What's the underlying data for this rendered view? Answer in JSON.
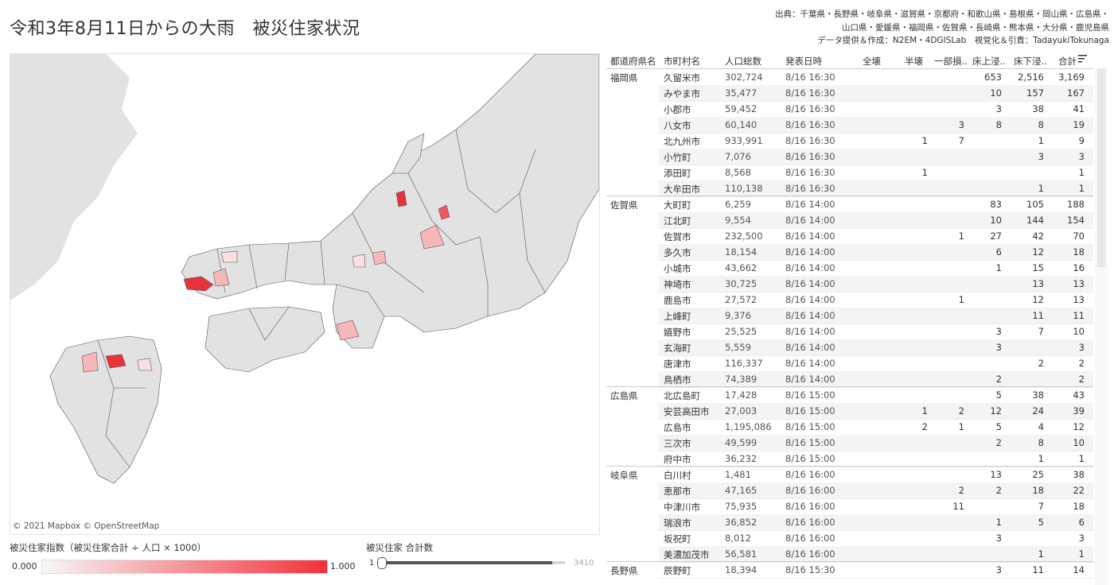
{
  "title": "令和3年8月11日からの大雨　被災住家状況",
  "source_lines": [
    "出典：千葉県・長野県・岐阜県・滋賀県・京都府・和歌山県・島根県・岡山県・広島県・",
    "山口県・愛媛県・福岡県・佐賀県・長崎県・熊本県・大分県・鹿児島県",
    "データ提供＆作成：N2EM・4DGISLab　視覚化＆引責：TadayukiTokunaga"
  ],
  "map": {
    "credit": "© 2021 Mapbox  © OpenStreetMap",
    "base_color": "#e2e2e2",
    "highlight_color": "#e8333c"
  },
  "legend": {
    "title": "被災住家指数（被災住家合計 ÷ 人口 × 1000）",
    "min": "0.000",
    "max": "1.000"
  },
  "slider": {
    "title": "被災住家 合計数",
    "min": "1",
    "max": "3410",
    "fill_fraction": 0.93
  },
  "table": {
    "headers": [
      "都道府県名",
      "市町村名",
      "人口総数",
      "発表日時",
      "全壊",
      "半壊",
      "一部損..",
      "床上浸..",
      "床下浸..",
      "合計"
    ],
    "groups": [
      {
        "pref": "福岡県",
        "rows": [
          [
            "久留米市",
            "302,724",
            "8/16 16:30",
            "",
            "",
            "",
            "653",
            "2,516",
            "3,169"
          ],
          [
            "みやま市",
            "35,477",
            "8/16 16:30",
            "",
            "",
            "",
            "10",
            "157",
            "167"
          ],
          [
            "小郡市",
            "59,452",
            "8/16 16:30",
            "",
            "",
            "",
            "3",
            "38",
            "41"
          ],
          [
            "八女市",
            "60,140",
            "8/16 16:30",
            "",
            "",
            "3",
            "8",
            "8",
            "19"
          ],
          [
            "北九州市",
            "933,991",
            "8/16 16:30",
            "",
            "1",
            "7",
            "",
            "1",
            "9"
          ],
          [
            "小竹町",
            "7,076",
            "8/16 16:30",
            "",
            "",
            "",
            "",
            "3",
            "3"
          ],
          [
            "添田町",
            "8,568",
            "8/16 16:30",
            "",
            "1",
            "",
            "",
            "",
            "1"
          ],
          [
            "大牟田市",
            "110,138",
            "8/16 16:30",
            "",
            "",
            "",
            "",
            "1",
            "1"
          ]
        ]
      },
      {
        "pref": "佐賀県",
        "rows": [
          [
            "大町町",
            "6,259",
            "8/16 14:00",
            "",
            "",
            "",
            "83",
            "105",
            "188"
          ],
          [
            "江北町",
            "9,554",
            "8/16 14:00",
            "",
            "",
            "",
            "10",
            "144",
            "154"
          ],
          [
            "佐賀市",
            "232,500",
            "8/16 14:00",
            "",
            "",
            "1",
            "27",
            "42",
            "70"
          ],
          [
            "多久市",
            "18,154",
            "8/16 14:00",
            "",
            "",
            "",
            "6",
            "12",
            "18"
          ],
          [
            "小城市",
            "43,662",
            "8/16 14:00",
            "",
            "",
            "",
            "1",
            "15",
            "16"
          ],
          [
            "神埼市",
            "30,725",
            "8/16 14:00",
            "",
            "",
            "",
            "",
            "13",
            "13"
          ],
          [
            "鹿島市",
            "27,572",
            "8/16 14:00",
            "",
            "",
            "1",
            "",
            "12",
            "13"
          ],
          [
            "上峰町",
            "9,376",
            "8/16 14:00",
            "",
            "",
            "",
            "",
            "11",
            "11"
          ],
          [
            "嬉野市",
            "25,525",
            "8/16 14:00",
            "",
            "",
            "",
            "3",
            "7",
            "10"
          ],
          [
            "玄海町",
            "5,559",
            "8/16 14:00",
            "",
            "",
            "",
            "3",
            "",
            "3"
          ],
          [
            "唐津市",
            "116,337",
            "8/16 14:00",
            "",
            "",
            "",
            "",
            "2",
            "2"
          ],
          [
            "鳥栖市",
            "74,389",
            "8/16 14:00",
            "",
            "",
            "",
            "2",
            "",
            "2"
          ]
        ]
      },
      {
        "pref": "広島県",
        "rows": [
          [
            "北広島町",
            "17,428",
            "8/16 15:00",
            "",
            "",
            "",
            "5",
            "38",
            "43"
          ],
          [
            "安芸高田市",
            "27,003",
            "8/16 15:00",
            "",
            "1",
            "2",
            "12",
            "24",
            "39"
          ],
          [
            "広島市",
            "1,195,086",
            "8/16 15:00",
            "",
            "2",
            "1",
            "5",
            "4",
            "12"
          ],
          [
            "三次市",
            "49,599",
            "8/16 15:00",
            "",
            "",
            "",
            "2",
            "8",
            "10"
          ],
          [
            "府中市",
            "36,232",
            "8/16 15:00",
            "",
            "",
            "",
            "",
            "1",
            "1"
          ]
        ]
      },
      {
        "pref": "岐阜県",
        "rows": [
          [
            "白川村",
            "1,481",
            "8/16 16:00",
            "",
            "",
            "",
            "13",
            "25",
            "38"
          ],
          [
            "恵那市",
            "47,165",
            "8/16 16:00",
            "",
            "",
            "2",
            "2",
            "18",
            "22"
          ],
          [
            "中津川市",
            "75,935",
            "8/16 16:00",
            "",
            "",
            "11",
            "",
            "7",
            "18"
          ],
          [
            "瑞浪市",
            "36,852",
            "8/16 16:00",
            "",
            "",
            "",
            "1",
            "5",
            "6"
          ],
          [
            "坂祝町",
            "8,012",
            "8/16 16:00",
            "",
            "",
            "",
            "3",
            "",
            "3"
          ],
          [
            "美濃加茂市",
            "56,581",
            "8/16 16:00",
            "",
            "",
            "",
            "",
            "1",
            "1"
          ]
        ]
      },
      {
        "pref": "長野県",
        "rows": [
          [
            "辰野町",
            "18,394",
            "8/16 15:30",
            "",
            "",
            "",
            "3",
            "11",
            "14"
          ]
        ]
      }
    ]
  }
}
